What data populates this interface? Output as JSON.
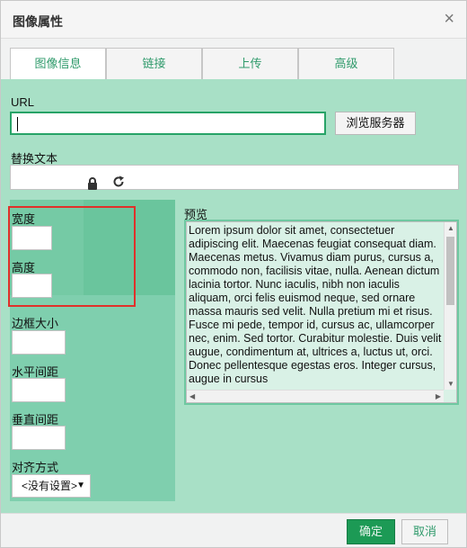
{
  "dialog": {
    "title": "图像属性",
    "close_icon": "close-icon"
  },
  "tabs": [
    {
      "label": "图像信息",
      "active": true
    },
    {
      "label": "链接",
      "active": false
    },
    {
      "label": "上传",
      "active": false
    },
    {
      "label": "高级",
      "active": false
    }
  ],
  "form": {
    "url_label": "URL",
    "url_value": "",
    "browse_label": "浏览服务器",
    "alt_label": "替换文本",
    "alt_value": "",
    "width_label": "宽度",
    "width_value": "",
    "height_label": "高度",
    "height_value": "",
    "lock_icon": "lock-icon",
    "reset_icon": "reset-size-icon",
    "border_label": "边框大小",
    "border_value": "",
    "hspace_label": "水平间距",
    "hspace_value": "",
    "vspace_label": "垂直间距",
    "vspace_value": "",
    "align_label": "对齐方式",
    "align_selected": "<没有设置>"
  },
  "preview": {
    "label": "预览",
    "text": "Lorem ipsum dolor sit amet, consectetuer adipiscing elit. Maecenas feugiat consequat diam. Maecenas metus. Vivamus diam purus, cursus a, commodo non, facilisis vitae, nulla. Aenean dictum lacinia tortor. Nunc iaculis, nibh non iaculis aliquam, orci felis euismod neque, sed ornare massa mauris sed velit. Nulla pretium mi et risus. Fusce mi pede, tempor id, cursus ac, ullamcorper nec, enim. Sed tortor. Curabitur molestie. Duis velit augue, condimentum at, ultrices a, luctus ut, orci. Donec pellentesque egestas eros. Integer cursus, augue in cursus"
  },
  "footer": {
    "ok_label": "确定",
    "cancel_label": "取消"
  },
  "colors": {
    "accent": "#1c9a55",
    "panel_bg": "#a8e0c6",
    "highlight_border": "#e0302a"
  }
}
